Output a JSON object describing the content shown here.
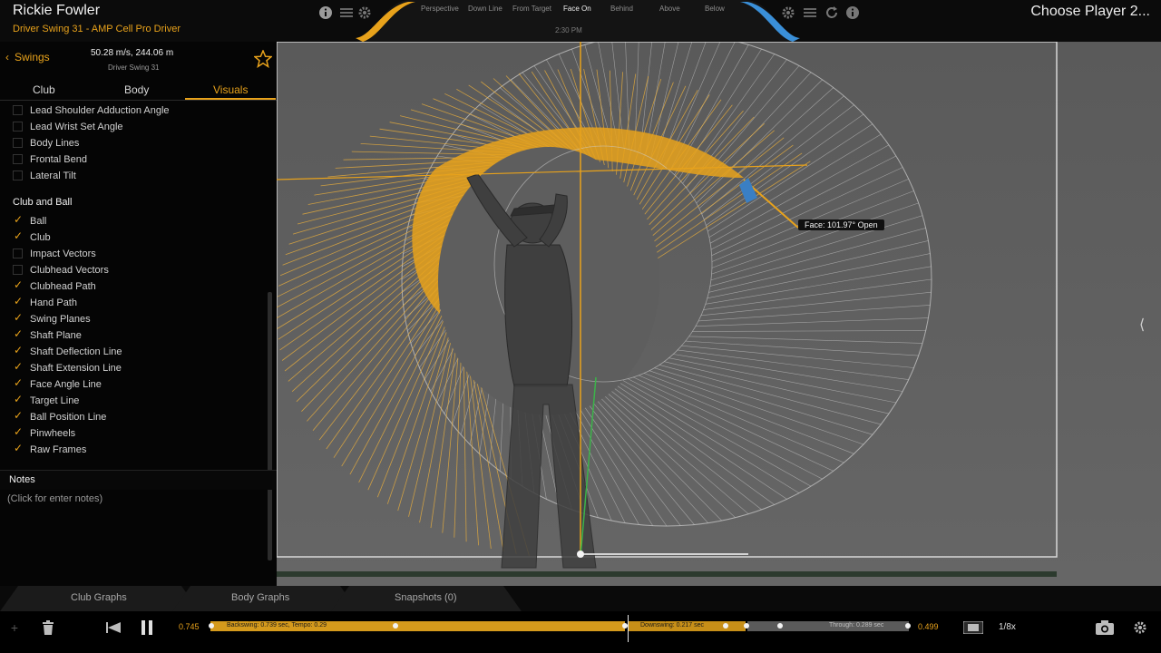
{
  "header": {
    "player_name": "Rickie Fowler",
    "swing_label": "Driver Swing 31 - AMP Cell Pro Driver",
    "time_display": "2:30 PM",
    "choose_player": "Choose Player 2...",
    "views": [
      "Perspective",
      "Down Line",
      "From Target",
      "Face On",
      "Behind",
      "Above",
      "Below"
    ],
    "active_view": "Face On"
  },
  "swing_header": {
    "back_label": "Swings",
    "stats": "50.28 m/s, 244.06 m",
    "sub": "Driver Swing 31"
  },
  "tabs": {
    "club": "Club",
    "body": "Body",
    "visuals": "Visuals",
    "active": "Visuals"
  },
  "body_options": [
    {
      "label": "Lead Shoulder Adduction Angle",
      "checked": false
    },
    {
      "label": "Lead Wrist Set Angle",
      "checked": false
    },
    {
      "label": "Body Lines",
      "checked": false
    },
    {
      "label": "Frontal Bend",
      "checked": false
    },
    {
      "label": "Lateral Tilt",
      "checked": false
    }
  ],
  "club_ball_title": "Club and Ball",
  "club_ball_options": [
    {
      "label": "Ball",
      "checked": true
    },
    {
      "label": "Club",
      "checked": true
    },
    {
      "label": "Impact Vectors",
      "checked": false
    },
    {
      "label": "Clubhead Vectors",
      "checked": false
    },
    {
      "label": "Clubhead Path",
      "checked": true
    },
    {
      "label": "Hand Path",
      "checked": true
    },
    {
      "label": "Swing Planes",
      "checked": true
    },
    {
      "label": "Shaft Plane",
      "checked": true
    },
    {
      "label": "Shaft Deflection Line",
      "checked": true
    },
    {
      "label": "Shaft Extension Line",
      "checked": true
    },
    {
      "label": "Face Angle Line",
      "checked": true
    },
    {
      "label": "Target Line",
      "checked": true
    },
    {
      "label": "Ball Position Line",
      "checked": true
    },
    {
      "label": "Pinwheels",
      "checked": true
    },
    {
      "label": "Raw Frames",
      "checked": true
    }
  ],
  "notes": {
    "title": "Notes",
    "placeholder": "(Click for enter notes)"
  },
  "viewport": {
    "face_label": "Face: 101.97° Open"
  },
  "bottom_tabs": {
    "club_graphs": "Club Graphs",
    "body_graphs": "Body Graphs",
    "snapshots": "Snapshots (0)"
  },
  "timeline": {
    "start_time": "0.745",
    "end_time": "0.499",
    "backswing_label": "Backswing: 0.739 sec, Tempo: 0.29",
    "downswing_label": "Downswing: 0.217 sec",
    "through_label": "Through: 0.289 sec",
    "speed": "1/8x"
  },
  "colors": {
    "accent": "#e8a21b",
    "panel": "#050505",
    "viewport": "#5e5e5e"
  }
}
